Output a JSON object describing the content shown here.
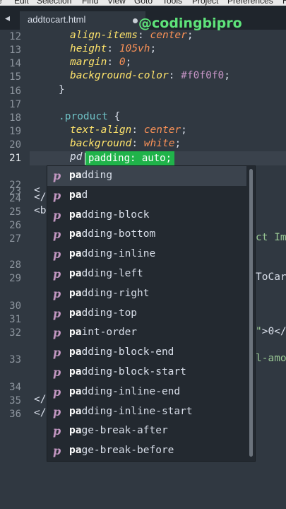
{
  "menubar": [
    "e",
    "Edit",
    "Selection",
    "Find",
    "View",
    "Goto",
    "Tools",
    "Project",
    "Preferences",
    "H"
  ],
  "tab": {
    "title": "addtocart.html"
  },
  "watermark": "@codingbipro",
  "lines": [
    {
      "n": "12",
      "parts": [
        {
          "c": "prop",
          "t": "align-items"
        },
        {
          "c": "punc",
          "t": ": "
        },
        {
          "c": "val",
          "t": "center"
        },
        {
          "c": "punc",
          "t": ";"
        }
      ]
    },
    {
      "n": "13",
      "parts": [
        {
          "c": "prop",
          "t": "height"
        },
        {
          "c": "punc",
          "t": ": "
        },
        {
          "c": "val",
          "t": "105vh"
        },
        {
          "c": "punc",
          "t": ";"
        }
      ]
    },
    {
      "n": "14",
      "parts": [
        {
          "c": "prop",
          "t": "margin"
        },
        {
          "c": "punc",
          "t": ": "
        },
        {
          "c": "val",
          "t": "0"
        },
        {
          "c": "punc",
          "t": ";"
        }
      ]
    },
    {
      "n": "15",
      "parts": [
        {
          "c": "prop",
          "t": "background-color"
        },
        {
          "c": "punc",
          "t": ": "
        },
        {
          "c": "hex",
          "t": "#f0f0f0"
        },
        {
          "c": "punc",
          "t": ";"
        }
      ]
    },
    {
      "n": "16",
      "parts": [
        {
          "c": "brace",
          "t": "}"
        }
      ]
    },
    {
      "n": "17",
      "parts": []
    },
    {
      "n": "18",
      "parts": [
        {
          "c": "sel",
          "t": ".product"
        },
        {
          "c": "brace",
          "t": " {"
        }
      ]
    },
    {
      "n": "19",
      "parts": [
        {
          "c": "prop",
          "t": "text-align"
        },
        {
          "c": "punc",
          "t": ": "
        },
        {
          "c": "val",
          "t": "center"
        },
        {
          "c": "punc",
          "t": ";"
        }
      ]
    },
    {
      "n": "20",
      "parts": [
        {
          "c": "prop",
          "t": "background"
        },
        {
          "c": "punc",
          "t": ": "
        },
        {
          "c": "val",
          "t": "white"
        },
        {
          "c": "punc",
          "t": ";"
        }
      ]
    },
    {
      "n": "21",
      "parts": [
        {
          "c": "typed",
          "t": "pd"
        }
      ]
    },
    {
      "n": "22",
      "parts": []
    },
    {
      "n": "23",
      "parts": [
        {
          "c": "frag",
          "t": "<"
        }
      ]
    },
    {
      "n": "24",
      "parts": [
        {
          "c": "frag",
          "t": "</"
        }
      ]
    },
    {
      "n": "25",
      "parts": [
        {
          "c": "frag",
          "t": "<b"
        }
      ]
    },
    {
      "n": "26",
      "parts": []
    },
    {
      "n": "27",
      "parts": [
        {
          "c": "frag-g",
          "t": "ct Im"
        }
      ]
    },
    {
      "n": "28",
      "parts": []
    },
    {
      "n": "29",
      "parts": [
        {
          "c": "frag",
          "t": "ToCar"
        }
      ]
    },
    {
      "n": "30",
      "parts": []
    },
    {
      "n": "31",
      "parts": []
    },
    {
      "n": "32",
      "parts": [
        {
          "c": "frag-g",
          "t": "\""
        },
        {
          "c": "frag",
          "t": ">0</"
        }
      ]
    },
    {
      "n": "33",
      "parts": [
        {
          "c": "frag-g",
          "t": "l-amo"
        }
      ]
    },
    {
      "n": "34",
      "parts": []
    },
    {
      "n": "35",
      "parts": [
        {
          "c": "frag",
          "t": "</"
        }
      ]
    },
    {
      "n": "36",
      "parts": [
        {
          "c": "frag",
          "t": "</"
        }
      ]
    }
  ],
  "inline_hint": "padding: auto;",
  "completions": {
    "kind_symbol": "p",
    "selected_index": 0,
    "items": [
      {
        "match": "pa",
        "rest": "dding"
      },
      {
        "match": "pa",
        "rest": "d"
      },
      {
        "match": "pa",
        "rest": "dding-block"
      },
      {
        "match": "pa",
        "rest": "dding-bottom"
      },
      {
        "match": "pa",
        "rest": "dding-inline"
      },
      {
        "match": "pa",
        "rest": "dding-left"
      },
      {
        "match": "pa",
        "rest": "dding-right"
      },
      {
        "match": "pa",
        "rest": "dding-top"
      },
      {
        "match": "pa",
        "rest": "int-order"
      },
      {
        "match": "pa",
        "rest": "dding-block-end"
      },
      {
        "match": "pa",
        "rest": "dding-block-start"
      },
      {
        "match": "pa",
        "rest": "dding-inline-end"
      },
      {
        "match": "pa",
        "rest": "dding-inline-start"
      },
      {
        "match": "pa",
        "rest": "ge-break-after"
      },
      {
        "match": "pa",
        "rest": "ge-break-before"
      }
    ]
  },
  "colors": {
    "editor_bg": "#303841",
    "hint_bg": "#20b34a",
    "watermark": "#5ee37a",
    "kind_icon": "#c397c2"
  }
}
